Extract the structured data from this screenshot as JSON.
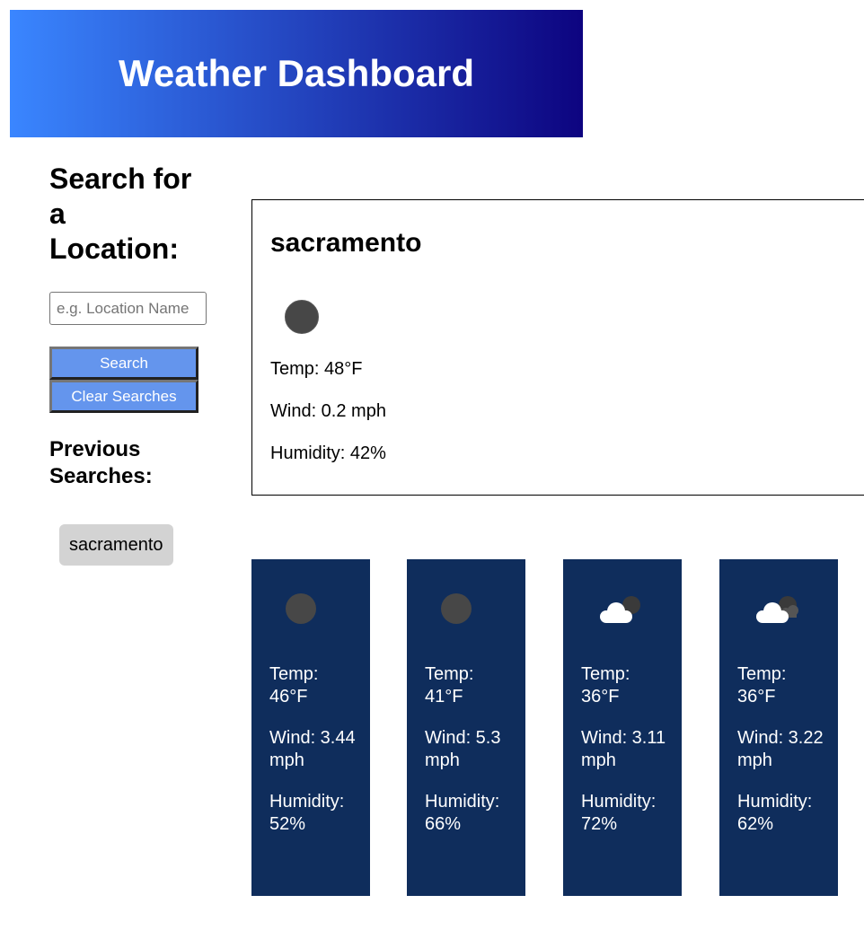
{
  "header": {
    "title": "Weather Dashboard"
  },
  "sidebar": {
    "search_title": "Search for a Location:",
    "search_placeholder": "e.g. Location Name",
    "search_button": "Search",
    "clear_button": "Clear Searches",
    "previous_title": "Previous Searches:",
    "history": [
      "sacramento"
    ]
  },
  "current": {
    "city": "sacramento",
    "icon": "moon-icon",
    "temp": "Temp: 48°F",
    "wind": "Wind: 0.2 mph",
    "humidity": "Humidity: 42%"
  },
  "forecast": [
    {
      "icon": "moon-icon",
      "temp": "Temp: 46°F",
      "wind": "Wind: 3.44 mph",
      "humidity": "Humidity: 52%"
    },
    {
      "icon": "moon-icon",
      "temp": "Temp: 41°F",
      "wind": "Wind: 5.3 mph",
      "humidity": "Humidity: 66%"
    },
    {
      "icon": "cloud-moon-icon",
      "temp": "Temp: 36°F",
      "wind": "Wind: 3.11 mph",
      "humidity": "Humidity: 72%"
    },
    {
      "icon": "clouds-moon-icon",
      "temp": "Temp: 36°F",
      "wind": "Wind: 3.22 mph",
      "humidity": "Humidity: 62%"
    }
  ],
  "colors": {
    "header_start": "#3a86ff",
    "header_end": "#0d0480",
    "button": "#6495ed",
    "forecast_card": "#0f2d5c",
    "history_button": "#d3d3d3"
  }
}
